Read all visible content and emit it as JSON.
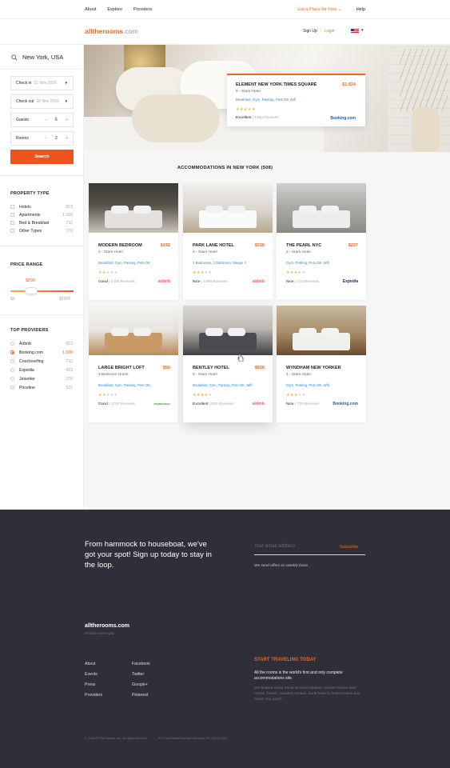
{
  "topnav": {
    "left": [
      "About",
      "Explore",
      "Providers"
    ],
    "list_place": "List a Place for Free",
    "chev": "⌄",
    "help": "Help"
  },
  "header": {
    "logo_main": "alltherooms",
    "logo_dom": ".com",
    "signup": "Sign Up",
    "sep": "|",
    "login": "Login",
    "caret": "▾"
  },
  "sidebar": {
    "location": "New York, USA",
    "checkin_label": "Check in",
    "checkin_date": "21 Nov 2016",
    "checkout_label": "Check out",
    "checkout_date": "30 Nov 2016",
    "guests_label": "Guests",
    "guests_value": "6",
    "rooms_label": "Rooms",
    "rooms_value": "2",
    "minus": "−",
    "plus": "+",
    "caret": "▾",
    "search": "Search",
    "property_title": "PROPERTY TYPE",
    "property_types": [
      {
        "label": "Hotels",
        "count": "813"
      },
      {
        "label": "Apartments",
        "count": "1,020"
      },
      {
        "label": "Bed & Breakfast",
        "count": "732"
      },
      {
        "label": "Other Types",
        "count": "270"
      }
    ],
    "price_title": "PRICE RANGE",
    "price_current": "$230",
    "price_current_fraction": 0.1,
    "price_min": "$0",
    "price_max": "$2900",
    "providers_title": "TOP PROVIDERS",
    "providers": [
      {
        "label": "Airbnb",
        "count": "813"
      },
      {
        "label": "Booking.com",
        "count": "1,020"
      },
      {
        "label": "Couchsurfing",
        "count": "732"
      },
      {
        "label": "Expedia",
        "count": "423"
      },
      {
        "label": "Jetsetter",
        "count": "270"
      },
      {
        "label": "Priceline",
        "count": "521"
      }
    ]
  },
  "hero": {
    "title": "ELEMENT NEW YORK TIMES SQUARE",
    "price": "$1,024",
    "subtitle": "5 - Stars Hotel",
    "amenities": "Breakfast, Gym, Parking, Pets OK,Wifi",
    "stars": "★★★★★",
    "rating": "Excellent",
    "reviews": "| 1900 Reviews",
    "provider": "Booking.com"
  },
  "main": {
    "acc_title": "ACCOMMODATIONS IN NEW YORK (508)",
    "cards": [
      {
        "title": "MODERN BEDROOM",
        "price": "$192",
        "sub": "3 - Stars Hotel",
        "amenities": "Breakfast, Gym, Parking, Pets OK",
        "stars_on": "★★",
        "stars_off": "★★★",
        "rating": "Good",
        "reviews": "| 2400 Reviews",
        "provider": "airbnb",
        "provider_color": "#ff5a5f"
      },
      {
        "title": "PARK LANE HOTEL",
        "price": "$330",
        "sub": "5 - Stars Hotel",
        "amenities": "2 Bedrooms, 1 Bathroom, Sleeps 4",
        "stars_on": "★★★",
        "stars_off": "★★",
        "rating": "Nice",
        "reviews": "| 1300 Reviews",
        "provider": "airbnb",
        "provider_color": "#ff5a5f"
      },
      {
        "title": "THE PEARL NYC",
        "price": "$227",
        "sub": "2 - Stars Hotel",
        "amenities": "Gym, Parking, Pets OK, Wifi",
        "stars_on": "★★★",
        "stars_off": "★★",
        "rating": "Nice",
        "reviews": "| 720 Reviews",
        "provider": "Expedia",
        "provider_color": "#1c2c4c"
      },
      {
        "title": "LARGE BRIGHT LOFT",
        "price": "$56",
        "sub": "3 Bedroom Home",
        "amenities": "Breakfast, Gym, Parking, Pets OK",
        "stars_on": "★★",
        "stars_off": "★★★",
        "rating": "Good",
        "reviews": "| 1700 Reviews",
        "provider": "tripadvisor",
        "provider_color": "#34a853"
      },
      {
        "title": "BENTLEY HOTEL",
        "price": "$920",
        "sub": "5 - Stars Hotel",
        "amenities": "Breakfast, Gym, Parking, Pets OK, Wifi",
        "stars_on": "★★★★",
        "stars_off": "★",
        "rating": "Excellent",
        "reviews": "| 500 Reviews",
        "provider": "airbnb",
        "provider_color": "#ff5a5f"
      },
      {
        "title": "WYNDHAM NEW YORKER",
        "price": "",
        "sub": "4 - Stars Hotel",
        "amenities": "Gym, Parking, Pets OK, Wifi",
        "stars_on": "★★★",
        "stars_off": "★★",
        "rating": "Nice",
        "reviews": "| 720 Reviews",
        "provider": "Booking.com",
        "provider_color": "#1a5fb4"
      }
    ]
  },
  "footer": {
    "headline": "From hammock to houseboat, we've got your spot! Sign up today to stay in the loop.",
    "email_placeholder": "Your email address",
    "subscribe": "Subscribe",
    "note": "We send offers on weekly basis",
    "logo": "alltherooms.com",
    "tagline": "Find the sweet spot.",
    "links_col1": [
      "About",
      "Events",
      "Press",
      "Providers"
    ],
    "links_col2": [
      "Facebook",
      "Twitter",
      "Google+",
      "Pinterest"
    ],
    "start_title": "START TRAVELING TODAY",
    "desc1": "All the rooms is the world's first and only complete accommodations site.",
    "desc2": "We feature every travel accommodation: private homes and rooms, hotels, vacation rentals, bunk beds to best-in class and more! Our goal?",
    "copyright": "© 2016 All The Rooms, Inc. All rights reserved.",
    "address": "374 Saint Marks Avenue, Brooklyn, NY 11201 USA"
  }
}
